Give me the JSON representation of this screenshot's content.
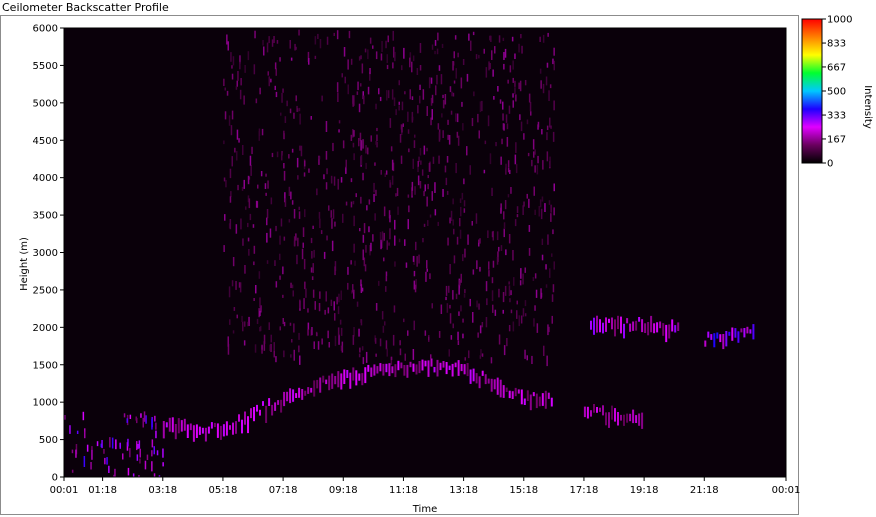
{
  "window": {
    "title": "Ceilometer Backscatter Profile"
  },
  "chart_data": {
    "type": "heatmap",
    "title": "Ceilometer Backscatter Profile",
    "xlabel": "Time",
    "ylabel": "Height (m)",
    "x_ticks": [
      "00:01",
      "01:18",
      "03:18",
      "05:18",
      "07:18",
      "09:18",
      "11:18",
      "13:18",
      "15:18",
      "17:18",
      "19:18",
      "21:18",
      "00:01"
    ],
    "x_tick_hours": [
      0.0167,
      1.3,
      3.3,
      5.3,
      7.3,
      9.3,
      11.3,
      13.3,
      15.3,
      17.3,
      19.3,
      21.3,
      24.0167
    ],
    "xlim_hours": [
      0.0167,
      24.0167
    ],
    "y_ticks": [
      0,
      500,
      1000,
      1500,
      2000,
      2500,
      3000,
      3500,
      4000,
      4500,
      5000,
      5500,
      6000
    ],
    "ylim": [
      0,
      6000
    ],
    "colorbar": {
      "label": "Intensity",
      "ticks": [
        1000,
        833,
        667,
        500,
        333,
        167,
        0
      ],
      "range": [
        0,
        1000
      ],
      "colors": [
        "#000000",
        "#6a005f",
        "#e000ff",
        "#1e00ff",
        "#00c8ff",
        "#00ff30",
        "#ffff00",
        "#ff8000",
        "#ff0000"
      ]
    },
    "layers": [
      {
        "name": "surface-layer",
        "start_h": 0.0167,
        "end_h": 3.3,
        "base_m": 0,
        "top_m": 900,
        "intensity": 300
      },
      {
        "name": "low-layer",
        "start_h": 0.0167,
        "end_h": 2.2,
        "base_m": 350,
        "top_m": 550,
        "intensity": 330
      },
      {
        "name": "boundary-layer-top",
        "points": [
          [
            3.3,
            750
          ],
          [
            5.3,
            700
          ],
          [
            7.3,
            1100
          ],
          [
            9.3,
            1400
          ],
          [
            11.3,
            1550
          ],
          [
            13.3,
            1500
          ],
          [
            15.3,
            1100
          ],
          [
            16.3,
            1100
          ]
        ],
        "intensity": 230
      },
      {
        "name": "residual-layer",
        "points": [
          [
            17.3,
            950
          ],
          [
            18.3,
            900
          ],
          [
            19.3,
            850
          ]
        ],
        "intensity": 200
      },
      {
        "name": "elevated-layer",
        "points": [
          [
            17.5,
            2100
          ],
          [
            19.3,
            2100
          ],
          [
            20.5,
            2080
          ]
        ],
        "intensity": 260
      },
      {
        "name": "elevated-layer-2",
        "points": [
          [
            21.3,
            1880
          ],
          [
            22.3,
            1950
          ],
          [
            23.0,
            2050
          ]
        ],
        "intensity": 330
      },
      {
        "name": "background-noise",
        "start_h": 5.3,
        "end_h": 16.3,
        "base_m": 1600,
        "top_m": 6000,
        "intensity": 140
      }
    ]
  }
}
